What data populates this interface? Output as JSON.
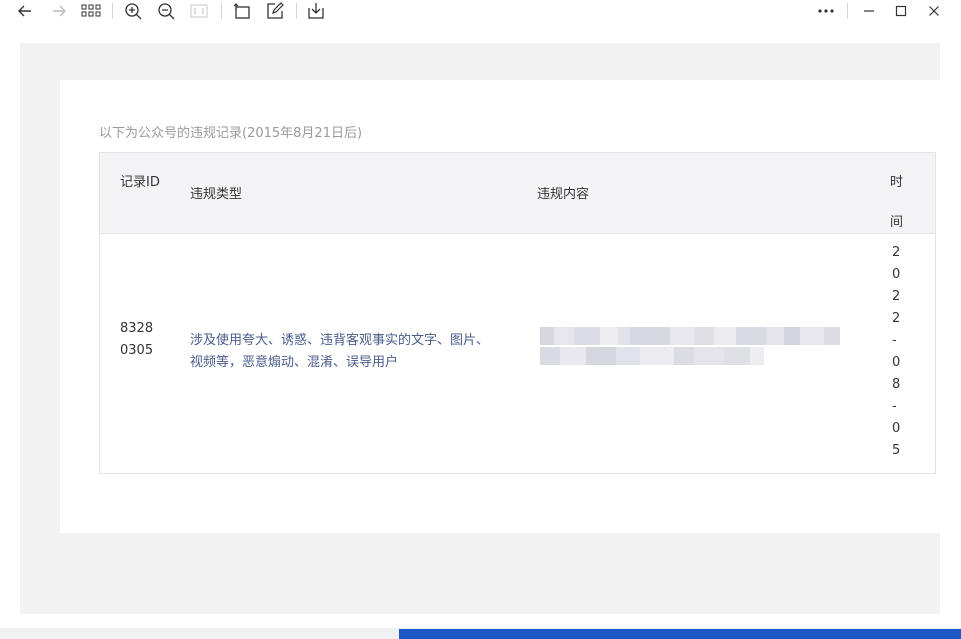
{
  "toolbar": {
    "buttons": [
      {
        "icon": "arrow-left-icon",
        "enabled": true
      },
      {
        "icon": "arrow-right-icon",
        "enabled": false
      },
      {
        "icon": "grid-icon",
        "enabled": true
      },
      {
        "icon": "zoom-in-icon",
        "enabled": true
      },
      {
        "icon": "zoom-out-icon",
        "enabled": true
      },
      {
        "icon": "actual-size-icon",
        "enabled": false
      },
      {
        "icon": "rotate-icon",
        "enabled": true
      },
      {
        "icon": "edit-icon",
        "enabled": true
      },
      {
        "icon": "download-icon",
        "enabled": true
      },
      {
        "icon": "more-icon",
        "enabled": true
      },
      {
        "icon": "minimize-icon",
        "enabled": true
      },
      {
        "icon": "maximize-icon",
        "enabled": true
      },
      {
        "icon": "close-icon",
        "enabled": true
      }
    ]
  },
  "document": {
    "caption": "以下为公众号的违规记录(2015年8月21日后)",
    "table": {
      "headers": {
        "id": "记录ID",
        "type": "违规类型",
        "content": "违规内容",
        "time": "时间"
      },
      "rows": [
        {
          "id": "83280305",
          "type": "涉及使用夸大、诱惑、违背客观事实的文字、图片、视频等，恶意煽动、混淆、误导用户",
          "content": "",
          "time": "2022-08-05"
        }
      ]
    }
  },
  "colors": {
    "viewer_bg": "#f2f2f3",
    "header_bg": "#f4f4f6",
    "link_text": "#4a5b8c",
    "caption_text": "#9a9a9a",
    "taskbar": "#1e57c6"
  }
}
